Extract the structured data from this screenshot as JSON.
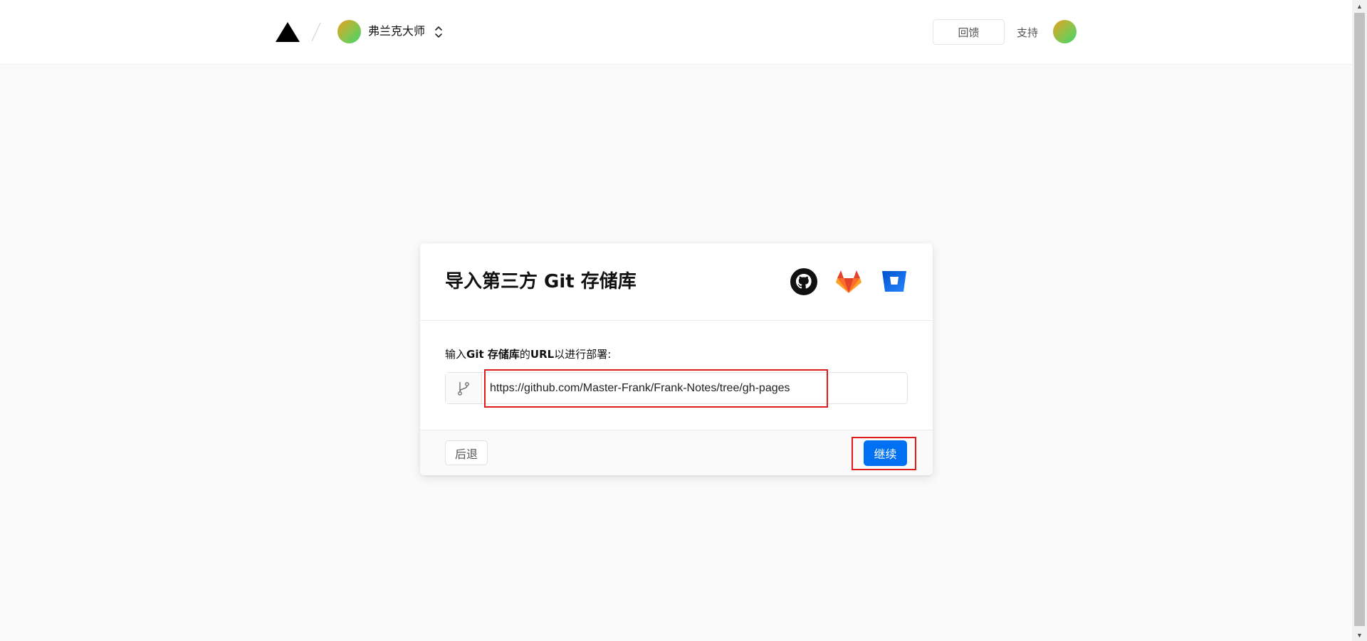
{
  "header": {
    "team_name": "弗兰克大师",
    "feedback_label": "回馈",
    "support_label": "支持"
  },
  "import_card": {
    "title": "导入第三方 Git 存储库",
    "providers": [
      "github-icon",
      "gitlab-icon",
      "bitbucket-icon"
    ],
    "label_prefix": "输入",
    "label_bold_1": "Git 存储库",
    "label_middle": "的",
    "label_bold_2": "URL",
    "label_suffix": "以进行部署:",
    "url_value": "https://github.com/Master-Frank/Frank-Notes/tree/gh-pages",
    "back_label": "后退",
    "continue_label": "继续"
  },
  "colors": {
    "accent": "#0070f3",
    "highlight_box": "#e01b1b",
    "background": "#fafafa"
  }
}
